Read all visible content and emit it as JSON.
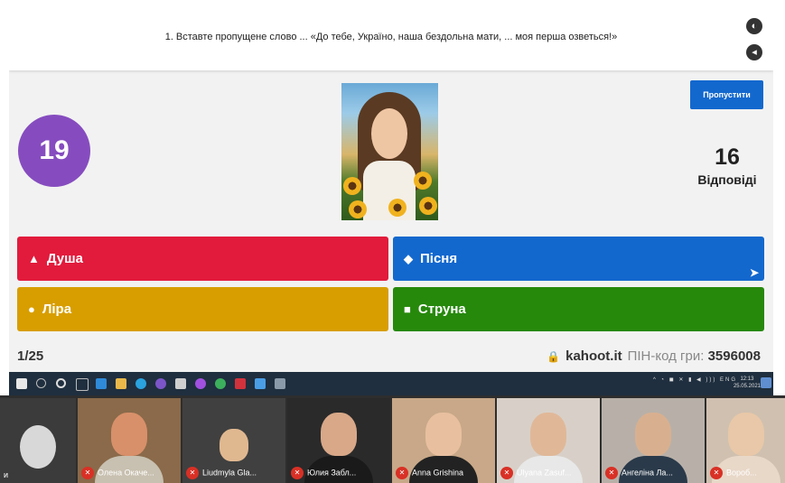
{
  "question": {
    "text": "1. Вставте пропущене слово ... «До тебе, Україно, наша бездольна мати, ... моя перша озветься!»"
  },
  "timer": {
    "value": "19",
    "color": "#864cbf"
  },
  "skip_button": {
    "label": "Пропустити"
  },
  "answers_count": {
    "value": "16",
    "label": "Відповіді"
  },
  "answers": [
    {
      "label": "Душа",
      "icon": "triangle-icon",
      "glyph": "▲",
      "color": "#e21b3c"
    },
    {
      "label": "Пісня",
      "icon": "diamond-icon",
      "glyph": "◆",
      "color": "#1368ce"
    },
    {
      "label": "Ліра",
      "icon": "circle-icon",
      "glyph": "●",
      "color": "#d89e00"
    },
    {
      "label": "Струна",
      "icon": "square-icon",
      "glyph": "■",
      "color": "#26890c"
    }
  ],
  "footer": {
    "progress": "1/25",
    "site": "kahoot.it",
    "pin_label": "ПІН-код гри:",
    "pin": "3596008"
  },
  "taskbar": {
    "time": "12:13",
    "date": "25.05.2021",
    "lang": "ENG"
  },
  "participants": [
    {
      "name": "и"
    },
    {
      "name": "Олена Окаче..."
    },
    {
      "name": "Liudmyla Gla..."
    },
    {
      "name": "Юлия Забл..."
    },
    {
      "name": "Anna Grishina"
    },
    {
      "name": "Ulyana Zasuf..."
    },
    {
      "name": "Ангеліна Ла..."
    },
    {
      "name": "Вороб..."
    }
  ]
}
